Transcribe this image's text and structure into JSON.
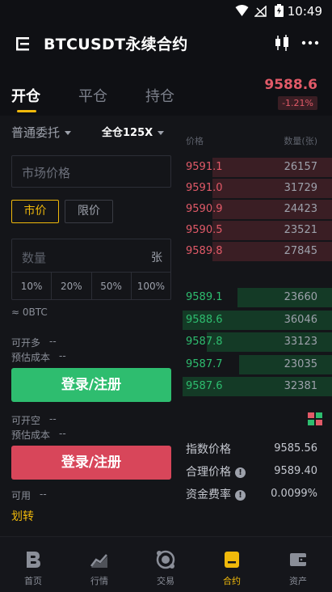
{
  "status_bar": {
    "time": "10:49"
  },
  "header": {
    "title": "BTCUSDT永续合约"
  },
  "tabs": [
    {
      "label": "开仓"
    },
    {
      "label": "平仓"
    },
    {
      "label": "持仓"
    }
  ],
  "ticker": {
    "last_price": "9588.6",
    "change": "-1.21%"
  },
  "order_form": {
    "order_type": "普通委托",
    "leverage": "全仓125X",
    "market_price_placeholder": "市场价格",
    "market_button": "市价",
    "limit_button": "限价",
    "qty_placeholder": "数量",
    "qty_unit": "张",
    "percents": [
      "10%",
      "20%",
      "50%",
      "100%"
    ],
    "btc_equiv": "≈ 0BTC",
    "long": {
      "open_label": "可开多",
      "open_value": "--",
      "cost_label": "预估成本",
      "cost_value": "--",
      "button": "登录/注册"
    },
    "short": {
      "open_label": "可开空",
      "open_value": "--",
      "cost_label": "预估成本",
      "cost_value": "--",
      "button": "登录/注册"
    },
    "available_label": "可用",
    "available_value": "--",
    "transfer": "划转"
  },
  "orderbook": {
    "price_header": "价格",
    "qty_header": "数量(张)",
    "asks": [
      {
        "price": "9591.1",
        "qty": "26157",
        "depth": 0.8
      },
      {
        "price": "9591.0",
        "qty": "31729",
        "depth": 0.8
      },
      {
        "price": "9590.9",
        "qty": "24423",
        "depth": 0.8
      },
      {
        "price": "9590.5",
        "qty": "23521",
        "depth": 0.8
      },
      {
        "price": "9589.8",
        "qty": "27845",
        "depth": 0.8
      }
    ],
    "bids": [
      {
        "price": "9589.1",
        "qty": "23660",
        "depth": 0.63
      },
      {
        "price": "9588.6",
        "qty": "36046",
        "depth": 1.0
      },
      {
        "price": "9587.8",
        "qty": "33123",
        "depth": 0.84
      },
      {
        "price": "9587.7",
        "qty": "23035",
        "depth": 0.62
      },
      {
        "price": "9587.6",
        "qty": "32381",
        "depth": 1.0
      }
    ]
  },
  "indices": [
    {
      "label": "指数价格",
      "value": "9585.56",
      "info": false
    },
    {
      "label": "合理价格",
      "value": "9589.40",
      "info": true
    },
    {
      "label": "资金费率",
      "value": "0.0099%",
      "info": true
    }
  ],
  "bottom_nav": [
    {
      "label": "首页",
      "icon": "home-logo-icon"
    },
    {
      "label": "行情",
      "icon": "chart-icon"
    },
    {
      "label": "交易",
      "icon": "trade-icon"
    },
    {
      "label": "合约",
      "icon": "contract-icon",
      "active": true
    },
    {
      "label": "资产",
      "icon": "wallet-icon"
    }
  ],
  "colors": {
    "accent": "#f0b90b",
    "up": "#2ebd6f",
    "down": "#e25a68",
    "background": "#0f1014"
  }
}
